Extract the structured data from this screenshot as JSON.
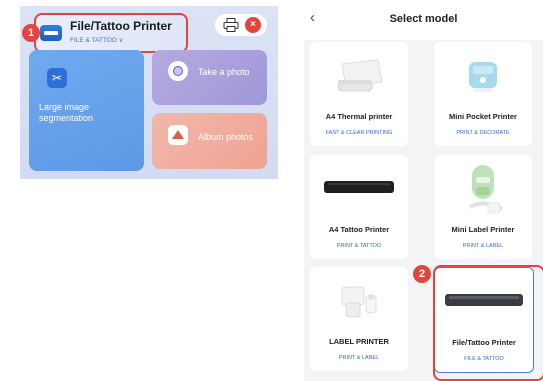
{
  "home": {
    "header": {
      "title": "File/Tattoo Printer",
      "subtitle": "FILE & TATTOO ∨"
    },
    "step_badge": "1",
    "tiles": {
      "large_image": "Large image segmentation",
      "take_photo": "Take a photo",
      "album": "Album photos"
    },
    "close_symbol": "×"
  },
  "select_model": {
    "back_symbol": "‹",
    "title": "Select model",
    "step_badge": "2",
    "models": [
      {
        "name": "A4 Thermal printer",
        "tag": "FAST & CLEAR PRINTING"
      },
      {
        "name": "Mini Pocket Printer",
        "tag": "PRINT & DECORATE"
      },
      {
        "name": "A4 Tattoo Printer",
        "tag": "PRINT & TATTOO"
      },
      {
        "name": "Mini Label Printer",
        "tag": "PRINT & LABEL"
      },
      {
        "name": "LABEL PRINTER",
        "tag": "PRINT & LABEL"
      },
      {
        "name": "File/Tattoo Printer",
        "tag": "FILE & TATTOO"
      }
    ]
  },
  "colors": {
    "accent_red": "#e3443f",
    "accent_blue": "#3a68d6"
  }
}
